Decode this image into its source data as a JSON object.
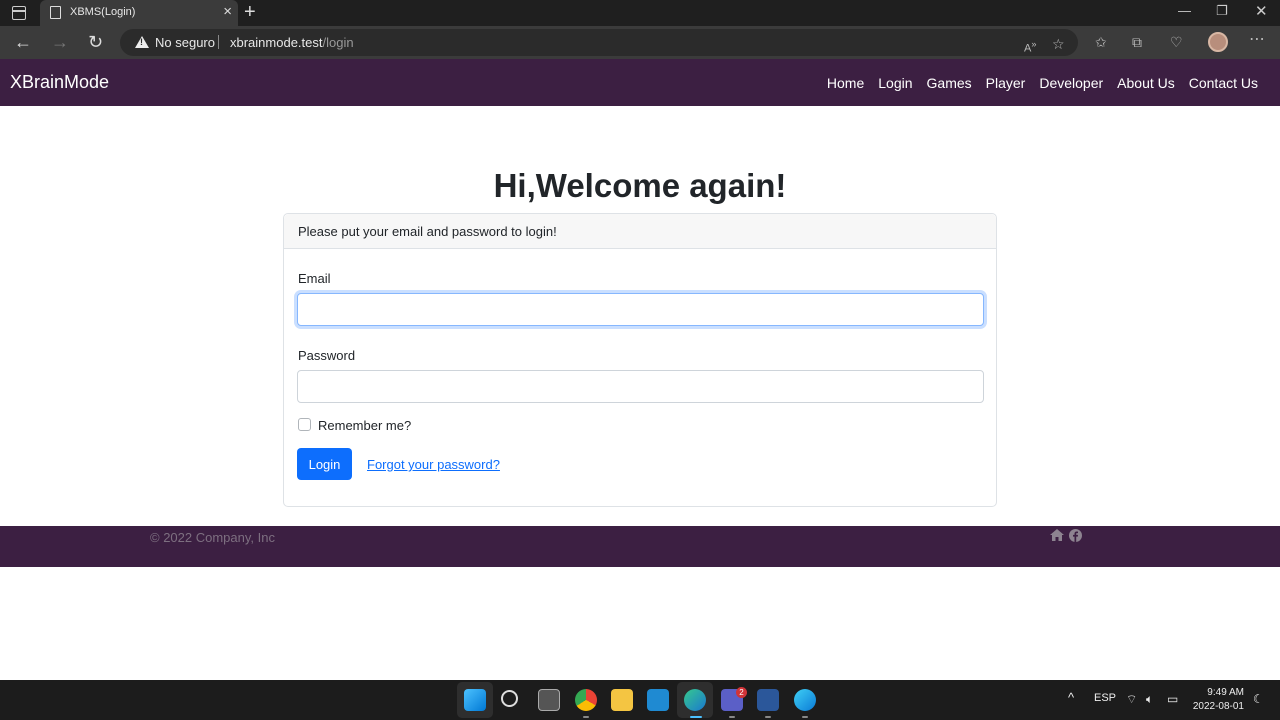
{
  "browser": {
    "tab_title": "XBMS(Login)",
    "security_label": "No seguro",
    "url_host": "xbrainmode.test",
    "url_path": "/login"
  },
  "site": {
    "brand": "XBrainMode",
    "nav": [
      "Home",
      "Login",
      "Games",
      "Player",
      "Developer",
      "About Us",
      "Contact Us"
    ]
  },
  "login": {
    "heading": "Hi,Welcome again!",
    "card_header": "Please put your email and password to login!",
    "email_label": "Email",
    "email_value": "",
    "password_label": "Password",
    "password_value": "",
    "remember_label": "Remember me?",
    "submit_label": "Login",
    "forgot_label": "Forgot your password?"
  },
  "footer": {
    "copyright": "© 2022 Company, Inc",
    "icons": [
      "home-icon",
      "facebook-icon"
    ]
  },
  "taskbar": {
    "language": "ESP",
    "time": "9:49 AM",
    "date": "2022-08-01",
    "teams_badge": "2",
    "apps": [
      "start-icon",
      "search-icon",
      "task-view-icon",
      "chrome-icon",
      "file-explorer-icon",
      "vscode-icon",
      "edge-icon",
      "teams-icon",
      "word-icon",
      "edge-dev-icon"
    ]
  },
  "colors": {
    "brand_purple": "#3c1f42",
    "primary": "#0d6efd"
  }
}
